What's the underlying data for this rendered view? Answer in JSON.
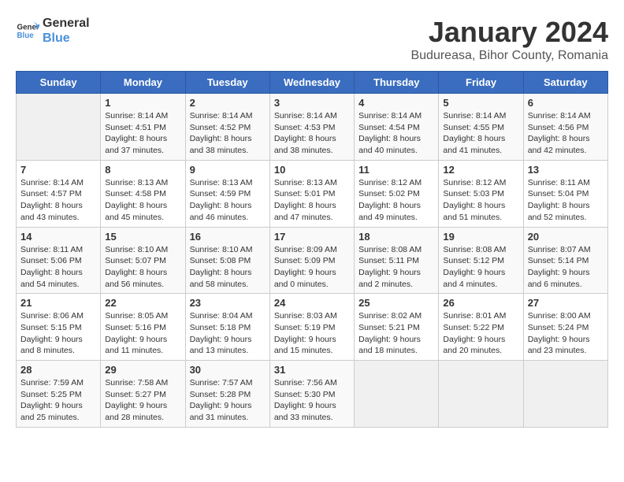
{
  "header": {
    "logo_line1": "General",
    "logo_line2": "Blue",
    "month": "January 2024",
    "location": "Budureasa, Bihor County, Romania"
  },
  "weekdays": [
    "Sunday",
    "Monday",
    "Tuesday",
    "Wednesday",
    "Thursday",
    "Friday",
    "Saturday"
  ],
  "weeks": [
    [
      {
        "day": "",
        "sunrise": "",
        "sunset": "",
        "daylight": ""
      },
      {
        "day": "1",
        "sunrise": "Sunrise: 8:14 AM",
        "sunset": "Sunset: 4:51 PM",
        "daylight": "Daylight: 8 hours and 37 minutes."
      },
      {
        "day": "2",
        "sunrise": "Sunrise: 8:14 AM",
        "sunset": "Sunset: 4:52 PM",
        "daylight": "Daylight: 8 hours and 38 minutes."
      },
      {
        "day": "3",
        "sunrise": "Sunrise: 8:14 AM",
        "sunset": "Sunset: 4:53 PM",
        "daylight": "Daylight: 8 hours and 38 minutes."
      },
      {
        "day": "4",
        "sunrise": "Sunrise: 8:14 AM",
        "sunset": "Sunset: 4:54 PM",
        "daylight": "Daylight: 8 hours and 40 minutes."
      },
      {
        "day": "5",
        "sunrise": "Sunrise: 8:14 AM",
        "sunset": "Sunset: 4:55 PM",
        "daylight": "Daylight: 8 hours and 41 minutes."
      },
      {
        "day": "6",
        "sunrise": "Sunrise: 8:14 AM",
        "sunset": "Sunset: 4:56 PM",
        "daylight": "Daylight: 8 hours and 42 minutes."
      }
    ],
    [
      {
        "day": "7",
        "sunrise": "Sunrise: 8:14 AM",
        "sunset": "Sunset: 4:57 PM",
        "daylight": "Daylight: 8 hours and 43 minutes."
      },
      {
        "day": "8",
        "sunrise": "Sunrise: 8:13 AM",
        "sunset": "Sunset: 4:58 PM",
        "daylight": "Daylight: 8 hours and 45 minutes."
      },
      {
        "day": "9",
        "sunrise": "Sunrise: 8:13 AM",
        "sunset": "Sunset: 4:59 PM",
        "daylight": "Daylight: 8 hours and 46 minutes."
      },
      {
        "day": "10",
        "sunrise": "Sunrise: 8:13 AM",
        "sunset": "Sunset: 5:01 PM",
        "daylight": "Daylight: 8 hours and 47 minutes."
      },
      {
        "day": "11",
        "sunrise": "Sunrise: 8:12 AM",
        "sunset": "Sunset: 5:02 PM",
        "daylight": "Daylight: 8 hours and 49 minutes."
      },
      {
        "day": "12",
        "sunrise": "Sunrise: 8:12 AM",
        "sunset": "Sunset: 5:03 PM",
        "daylight": "Daylight: 8 hours and 51 minutes."
      },
      {
        "day": "13",
        "sunrise": "Sunrise: 8:11 AM",
        "sunset": "Sunset: 5:04 PM",
        "daylight": "Daylight: 8 hours and 52 minutes."
      }
    ],
    [
      {
        "day": "14",
        "sunrise": "Sunrise: 8:11 AM",
        "sunset": "Sunset: 5:06 PM",
        "daylight": "Daylight: 8 hours and 54 minutes."
      },
      {
        "day": "15",
        "sunrise": "Sunrise: 8:10 AM",
        "sunset": "Sunset: 5:07 PM",
        "daylight": "Daylight: 8 hours and 56 minutes."
      },
      {
        "day": "16",
        "sunrise": "Sunrise: 8:10 AM",
        "sunset": "Sunset: 5:08 PM",
        "daylight": "Daylight: 8 hours and 58 minutes."
      },
      {
        "day": "17",
        "sunrise": "Sunrise: 8:09 AM",
        "sunset": "Sunset: 5:09 PM",
        "daylight": "Daylight: 9 hours and 0 minutes."
      },
      {
        "day": "18",
        "sunrise": "Sunrise: 8:08 AM",
        "sunset": "Sunset: 5:11 PM",
        "daylight": "Daylight: 9 hours and 2 minutes."
      },
      {
        "day": "19",
        "sunrise": "Sunrise: 8:08 AM",
        "sunset": "Sunset: 5:12 PM",
        "daylight": "Daylight: 9 hours and 4 minutes."
      },
      {
        "day": "20",
        "sunrise": "Sunrise: 8:07 AM",
        "sunset": "Sunset: 5:14 PM",
        "daylight": "Daylight: 9 hours and 6 minutes."
      }
    ],
    [
      {
        "day": "21",
        "sunrise": "Sunrise: 8:06 AM",
        "sunset": "Sunset: 5:15 PM",
        "daylight": "Daylight: 9 hours and 8 minutes."
      },
      {
        "day": "22",
        "sunrise": "Sunrise: 8:05 AM",
        "sunset": "Sunset: 5:16 PM",
        "daylight": "Daylight: 9 hours and 11 minutes."
      },
      {
        "day": "23",
        "sunrise": "Sunrise: 8:04 AM",
        "sunset": "Sunset: 5:18 PM",
        "daylight": "Daylight: 9 hours and 13 minutes."
      },
      {
        "day": "24",
        "sunrise": "Sunrise: 8:03 AM",
        "sunset": "Sunset: 5:19 PM",
        "daylight": "Daylight: 9 hours and 15 minutes."
      },
      {
        "day": "25",
        "sunrise": "Sunrise: 8:02 AM",
        "sunset": "Sunset: 5:21 PM",
        "daylight": "Daylight: 9 hours and 18 minutes."
      },
      {
        "day": "26",
        "sunrise": "Sunrise: 8:01 AM",
        "sunset": "Sunset: 5:22 PM",
        "daylight": "Daylight: 9 hours and 20 minutes."
      },
      {
        "day": "27",
        "sunrise": "Sunrise: 8:00 AM",
        "sunset": "Sunset: 5:24 PM",
        "daylight": "Daylight: 9 hours and 23 minutes."
      }
    ],
    [
      {
        "day": "28",
        "sunrise": "Sunrise: 7:59 AM",
        "sunset": "Sunset: 5:25 PM",
        "daylight": "Daylight: 9 hours and 25 minutes."
      },
      {
        "day": "29",
        "sunrise": "Sunrise: 7:58 AM",
        "sunset": "Sunset: 5:27 PM",
        "daylight": "Daylight: 9 hours and 28 minutes."
      },
      {
        "day": "30",
        "sunrise": "Sunrise: 7:57 AM",
        "sunset": "Sunset: 5:28 PM",
        "daylight": "Daylight: 9 hours and 31 minutes."
      },
      {
        "day": "31",
        "sunrise": "Sunrise: 7:56 AM",
        "sunset": "Sunset: 5:30 PM",
        "daylight": "Daylight: 9 hours and 33 minutes."
      },
      {
        "day": "",
        "sunrise": "",
        "sunset": "",
        "daylight": ""
      },
      {
        "day": "",
        "sunrise": "",
        "sunset": "",
        "daylight": ""
      },
      {
        "day": "",
        "sunrise": "",
        "sunset": "",
        "daylight": ""
      }
    ]
  ]
}
